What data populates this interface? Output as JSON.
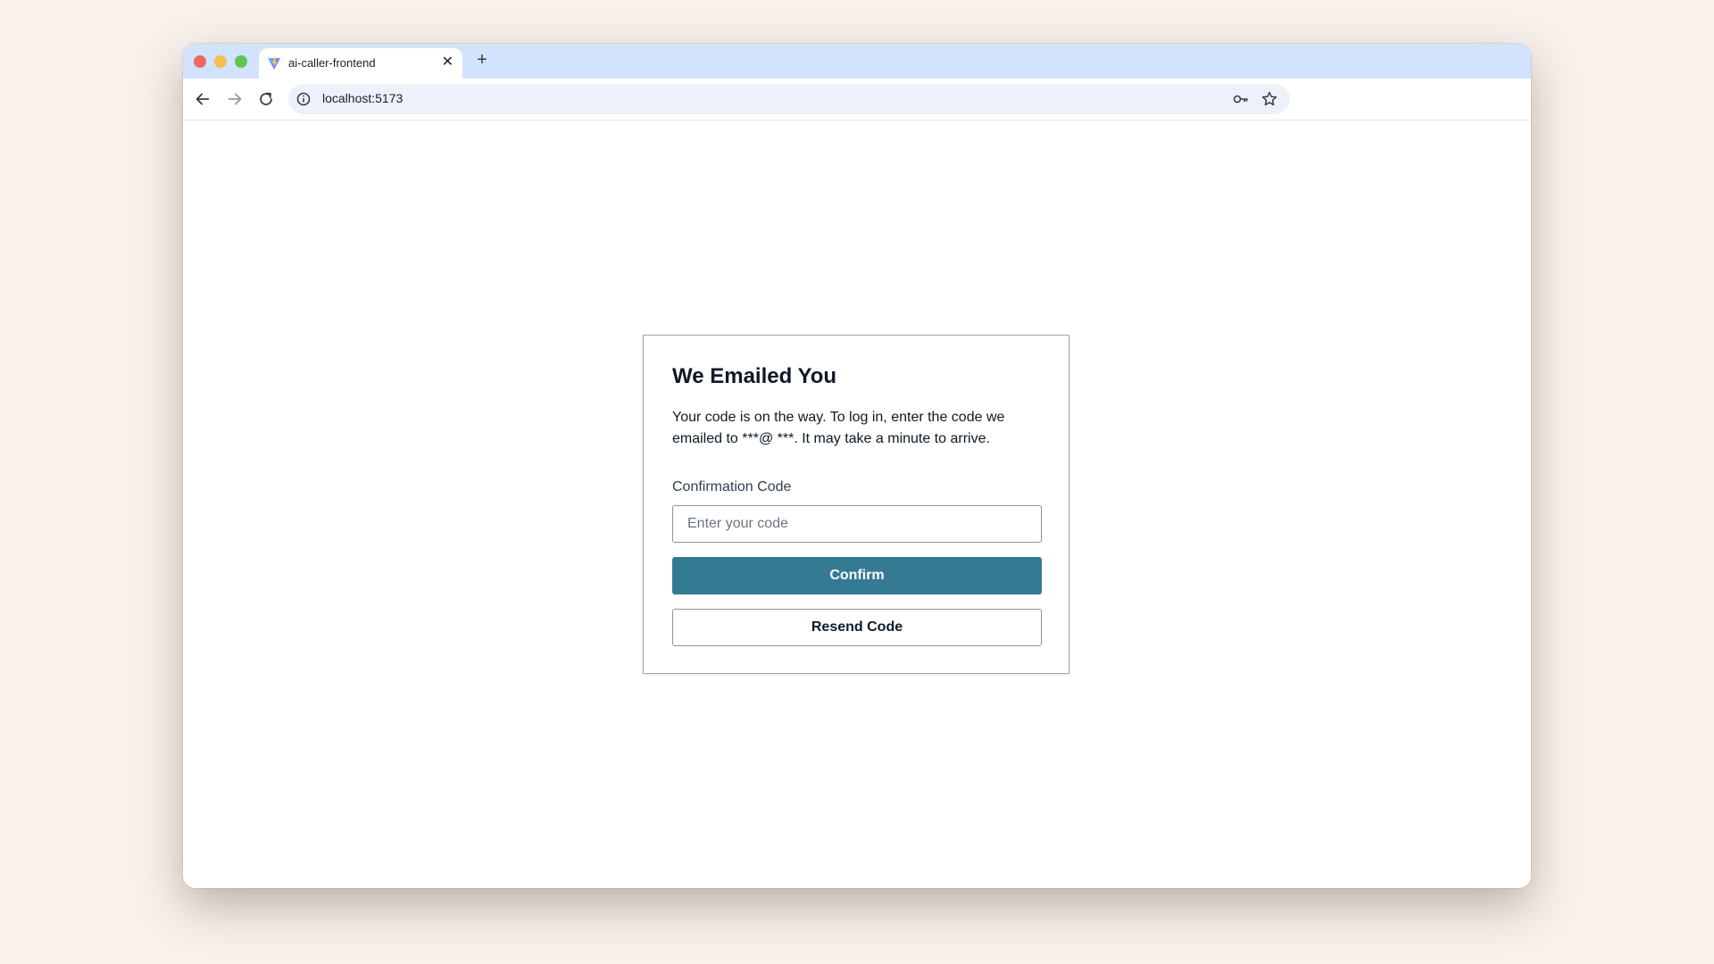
{
  "browser": {
    "tab": {
      "title": "ai-caller-frontend",
      "close_glyph": "✕",
      "favicon": "vite-logo-icon"
    },
    "new_tab_glyph": "+",
    "address": "localhost:5173",
    "icons": {
      "back": "arrow-left-icon",
      "forward": "arrow-right-icon",
      "reload": "reload-icon",
      "site_info": "info-icon",
      "passwords": "key-icon",
      "bookmark": "star-icon"
    }
  },
  "card": {
    "title": "We Emailed You",
    "description": "Your code is on the way. To log in, enter the code we emailed to  ***@  ***. It may take a minute to arrive.",
    "field_label": "Confirmation Code",
    "input_value": "",
    "input_placeholder": "Enter your code",
    "confirm_label": "Confirm",
    "resend_label": "Resend Code"
  },
  "colors": {
    "background": "#f8f1ec",
    "tab_strip": "#d3e3fd",
    "primary_button": "#357a93",
    "text": "#0d1a26"
  }
}
